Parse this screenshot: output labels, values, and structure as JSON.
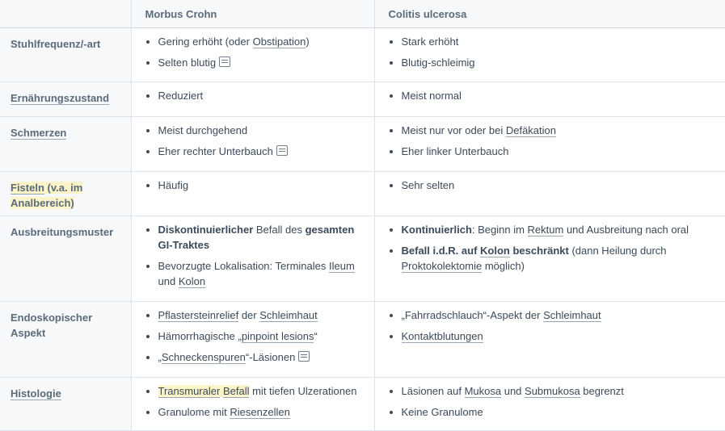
{
  "header": {
    "col_crohn": "Morbus Crohn",
    "col_colitis": "Colitis ulcerosa"
  },
  "rows": [
    {
      "label": "Stuhlfrequenz/-art",
      "crohn": {
        "i0": {
          "a": "Gering erhöht (oder ",
          "b": "Obstipation",
          "c": ")"
        },
        "i1": "Selten blutig"
      },
      "colitis": {
        "i0": "Stark erhöht",
        "i1": "Blutig-schleimig"
      }
    },
    {
      "label": "Ernährungszustand",
      "crohn": {
        "i0": "Reduziert"
      },
      "colitis": {
        "i0": "Meist normal"
      }
    },
    {
      "label": "Schmerzen",
      "crohn": {
        "i0": "Meist durchgehend",
        "i1": "Eher rechter Unterbauch"
      },
      "colitis": {
        "i0": {
          "a": "Meist nur vor oder bei ",
          "b": "Defäkation"
        },
        "i1": "Eher linker Unterbauch"
      }
    },
    {
      "label": {
        "a": "Fisteln",
        "b": " (v.a. im Analbereich)"
      },
      "crohn": {
        "i0": "Häufig"
      },
      "colitis": {
        "i0": "Sehr selten"
      }
    },
    {
      "label": "Ausbreitungsmuster",
      "crohn": {
        "i0": {
          "a": "Diskontinuierlicher",
          "b": " Befall des ",
          "c": "gesamten GI-Traktes"
        },
        "i1": {
          "a": "Bevorzugte Lokalisation: Terminales ",
          "b": "Ileum",
          "c": " und ",
          "d": "Kolon"
        }
      },
      "colitis": {
        "i0": {
          "a": "Kontinuierlich",
          "b": ": Beginn im ",
          "c": "Rektum",
          "d": " und Ausbreitung nach oral"
        },
        "i1": {
          "a": "Befall i.d.R. auf ",
          "b": "Kolon",
          "c": " beschränkt",
          "d": " (dann Heilung durch ",
          "e": "Proktokolektomie",
          "f": " möglich)"
        }
      }
    },
    {
      "label": "Endoskopischer Aspekt",
      "crohn": {
        "i0": {
          "a": "Pflastersteinrelief",
          "b": " der ",
          "c": "Schleimhaut"
        },
        "i1": {
          "a": "Hämorrhagische „",
          "b": "pinpoint lesions",
          "c": "“"
        },
        "i2": {
          "a": "„",
          "b": "Schneckenspuren",
          "c": "“-Läsionen"
        }
      },
      "colitis": {
        "i0": {
          "a": "„Fahrradschlauch“-Aspekt der ",
          "b": "Schleimhaut"
        },
        "i1": "Kontaktblutungen"
      }
    },
    {
      "label": "Histologie",
      "crohn": {
        "i0": {
          "a": "Transmuraler",
          "b": " ",
          "c": "Befall",
          "d": " mit tiefen Ulzerationen"
        },
        "i1": {
          "a": "Granulome mit ",
          "b": "Riesenzellen"
        }
      },
      "colitis": {
        "i0": {
          "a": "Läsionen auf ",
          "b": "Mukosa",
          "c": " und ",
          "d": "Submukosa",
          "e": " begrenzt"
        },
        "i1": "Keine Granulome"
      }
    }
  ],
  "icons": {
    "note": "note-icon"
  },
  "colors": {
    "header_bg": "#f6f8fa",
    "text": "#3b4a5a",
    "highlight": "#fbf4c9"
  }
}
